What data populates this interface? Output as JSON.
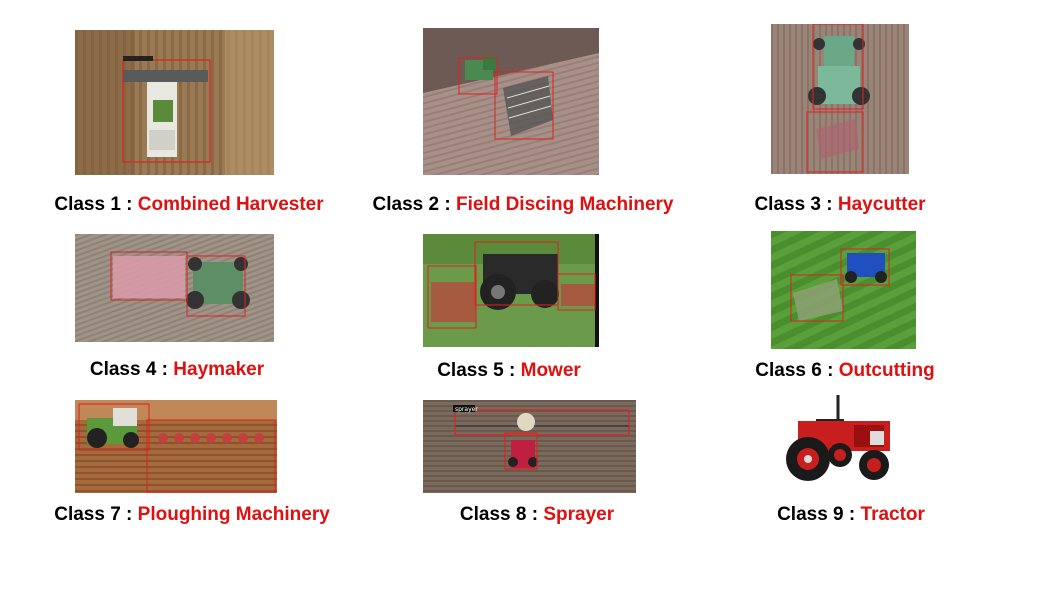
{
  "colors": {
    "name": "#e01010",
    "box": "#e02020"
  },
  "classes": [
    {
      "prefix": "Class 1 :",
      "name": "Combined Harvester"
    },
    {
      "prefix": "Class 2 :",
      "name": "Field Discing Machinery"
    },
    {
      "prefix": "Class 3 :",
      "name": "Haycutter"
    },
    {
      "prefix": "Class 4 :",
      "name": "Haymaker"
    },
    {
      "prefix": "Class 5 :",
      "name": "Mower"
    },
    {
      "prefix": "Class 6 :",
      "name": "Outcutting"
    },
    {
      "prefix": "Class 7 :",
      "name": "Ploughing Machinery"
    },
    {
      "prefix": "Class 8 :",
      "name": "Sprayer"
    },
    {
      "prefix": "Class 9 :",
      "name": "Tractor"
    }
  ],
  "image_labels": {
    "sprayer": "sprayer"
  }
}
